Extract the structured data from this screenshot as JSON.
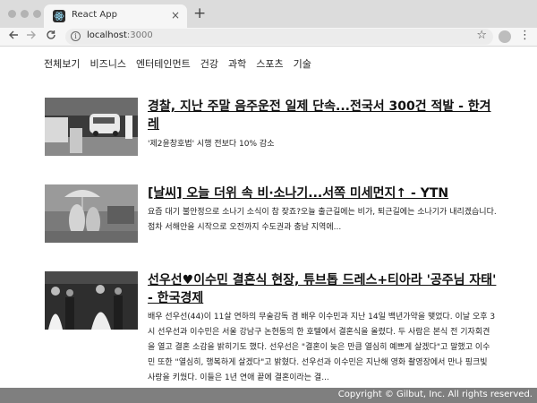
{
  "browser": {
    "tab_title": "React App",
    "tab_close": "×",
    "new_tab": "+",
    "url_host": "localhost",
    "url_port": ":3000",
    "icons": [
      "react-favicon",
      "back-arrow-icon",
      "forward-arrow-icon",
      "reload-icon",
      "info-icon",
      "star-icon",
      "profile-icon",
      "menu-dots-icon"
    ]
  },
  "categories": [
    "전체보기",
    "비즈니스",
    "엔터테인먼트",
    "건강",
    "과학",
    "스포츠",
    "기술"
  ],
  "articles": [
    {
      "title": "경찰, 지난 주말 음주운전 일제 단속...전국서 300건 적발 - 한겨레",
      "description": "'제2윤창호법' 시행 전보다 10% 감소"
    },
    {
      "title": "[날씨] 오늘 더위 속 비·소나기...서쪽 미세먼지↑ - YTN",
      "description": "요즘 대기 불안정으로 소나기 소식이 참 잦죠?오늘 출근길에는 비가, 퇴근길에는 소나기가 내리겠습니다.점차 서해안을 시작으로 오전까지 수도권과 충남 지역에..."
    },
    {
      "title": "선우선♥이수민 결혼식 현장, 튜브톱 드레스+티아라 '공주님 자태' - 한국경제",
      "description": "배우 선우선(44)이 11살 연하의 무술감독 겸 배우 이수민과 지난 14일 백년가약을 맺었다. 이날 오후 3시 선우선과 이수민은 서울 강남구 논현동의 한 호텔에서 결혼식을 올렸다. 두 사람은 본식 전 기자회견을 열고 결혼 소감을 밝히기도 했다. 선우선은 \"결혼이 늦은 만큼 열심히 예쁘게 살겠다\"고 말했고 이수민 또한 \"열심히, 행복하게 살겠다\"고 밝혔다. 선우선과 이수민은 지난해 영화 촬영장에서 만나 핑크빛 사랑을 키웠다. 이들은 1년 연애 끝에 결혼이라는 결..."
    }
  ],
  "footer": {
    "copyright": "Copyright © Gilbut, Inc. All rights reserved."
  }
}
